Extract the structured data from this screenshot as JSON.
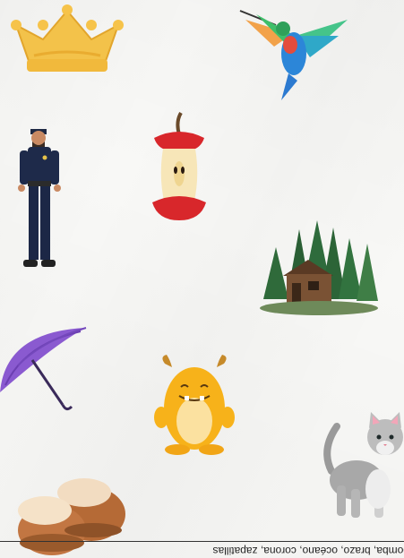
{
  "worksheet": {
    "footer_text": "bomba, brazo, océano, corona, zapatillas",
    "items": [
      {
        "name": "crown-icon"
      },
      {
        "name": "hummingbird-icon"
      },
      {
        "name": "police-officer-icon"
      },
      {
        "name": "apple-core-icon"
      },
      {
        "name": "forest-cabin-icon"
      },
      {
        "name": "umbrella-icon"
      },
      {
        "name": "monster-icon"
      },
      {
        "name": "cat-icon"
      },
      {
        "name": "slippers-icon"
      }
    ]
  }
}
